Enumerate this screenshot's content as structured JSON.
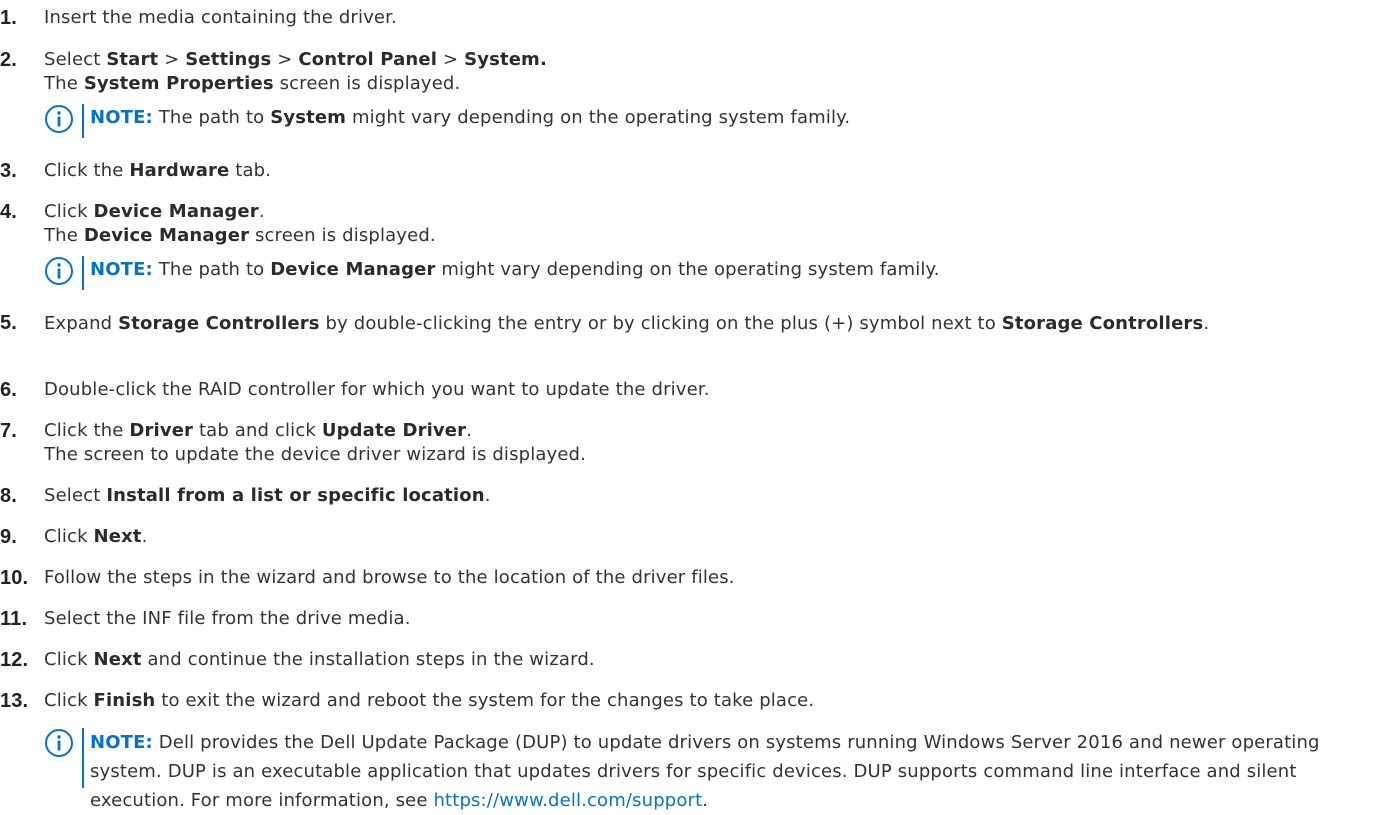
{
  "icons": {
    "note": "info-circle-icon"
  },
  "colors": {
    "accent": "#0672CB",
    "text": "#333333"
  },
  "steps": [
    {
      "number": "1.",
      "parts": [
        {
          "text": "Insert the media containing the driver."
        }
      ]
    },
    {
      "number": "2.",
      "line1": [
        {
          "text": "Select "
        },
        {
          "b": "Start"
        },
        {
          "text": " > "
        },
        {
          "b": "Settings"
        },
        {
          "text": " > "
        },
        {
          "b": "Control Panel"
        },
        {
          "text": " > "
        },
        {
          "b": "System."
        }
      ],
      "line2": [
        {
          "text": "The "
        },
        {
          "b": "System Properties"
        },
        {
          "text": " screen is displayed."
        }
      ],
      "note": {
        "label": "NOTE:",
        "parts": [
          {
            "text": " The path to "
          },
          {
            "b": "System"
          },
          {
            "text": " might vary depending on the operating system family."
          }
        ]
      }
    },
    {
      "number": "3.",
      "parts": [
        {
          "text": "Click the "
        },
        {
          "b": "Hardware"
        },
        {
          "text": " tab."
        }
      ]
    },
    {
      "number": "4.",
      "line1": [
        {
          "text": "Click "
        },
        {
          "b": "Device Manager"
        },
        {
          "text": "."
        }
      ],
      "line2": [
        {
          "text": "The "
        },
        {
          "b": "Device Manager"
        },
        {
          "text": " screen is displayed."
        }
      ],
      "note": {
        "label": "NOTE:",
        "parts": [
          {
            "text": " The path to "
          },
          {
            "b": "Device Manager"
          },
          {
            "text": " might vary depending on the operating system family."
          }
        ]
      }
    },
    {
      "number": "5.",
      "parts": [
        {
          "text": "Expand "
        },
        {
          "b": "Storage Controllers"
        },
        {
          "text": " by double-clicking the entry or by clicking on the plus (+) symbol next to "
        },
        {
          "b": "Storage Controllers"
        },
        {
          "text": "."
        }
      ]
    },
    {
      "number": "6.",
      "parts": [
        {
          "text": "Double-click the RAID controller for which you want to update the driver."
        }
      ]
    },
    {
      "number": "7.",
      "line1": [
        {
          "text": "Click the "
        },
        {
          "b": "Driver"
        },
        {
          "text": " tab and click "
        },
        {
          "b": "Update Driver"
        },
        {
          "text": "."
        }
      ],
      "line2": [
        {
          "text": "The screen to update the device driver wizard is displayed."
        }
      ]
    },
    {
      "number": "8.",
      "parts": [
        {
          "text": "Select "
        },
        {
          "b": "Install from a list or specific location"
        },
        {
          "text": "."
        }
      ]
    },
    {
      "number": "9.",
      "parts": [
        {
          "text": "Click "
        },
        {
          "b": "Next"
        },
        {
          "text": "."
        }
      ]
    },
    {
      "number": "10.",
      "parts": [
        {
          "text": "Follow the steps in the wizard and browse to the location of the driver files."
        }
      ]
    },
    {
      "number": "11.",
      "parts": [
        {
          "text": "Select the INF file from the drive media."
        }
      ]
    },
    {
      "number": "12.",
      "parts": [
        {
          "text": "Click "
        },
        {
          "b": "Next"
        },
        {
          "text": " and continue the installation steps in the wizard."
        }
      ]
    },
    {
      "number": "13.",
      "parts": [
        {
          "text": "Click "
        },
        {
          "b": "Finish"
        },
        {
          "text": " to exit the wizard and reboot the system for the changes to take place."
        }
      ]
    }
  ],
  "final_note": {
    "label": "NOTE:",
    "text": " Dell provides the Dell Update Package (DUP) to update drivers on systems running Windows Server 2016 and newer operating system. DUP is an executable application that updates drivers for specific devices. DUP supports command line interface and silent execution. For more information, see ",
    "link": "https://www.dell.com/support",
    "end": "."
  }
}
